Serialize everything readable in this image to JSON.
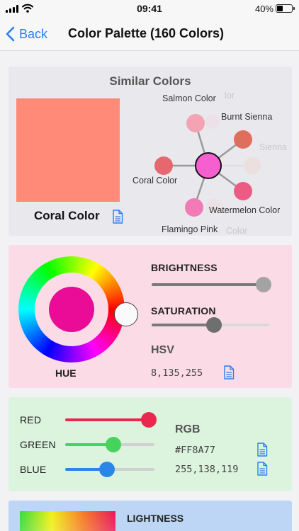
{
  "status": {
    "time": "09:41",
    "battery_pct": "40%",
    "battery_level": 0.4
  },
  "nav": {
    "back_label": "Back",
    "title": "Color Palette (160 Colors)"
  },
  "similar": {
    "title": "Similar Colors",
    "color_name": "Coral Color",
    "color_hex": "#FF8A77",
    "center_color": "#f55fcf",
    "nodes": [
      {
        "name": "Salmon Color",
        "color": "#f4a3b2"
      },
      {
        "name": "Burnt Sienna",
        "color": "#e06e5d"
      },
      {
        "name": "Coral Color",
        "color": "#e5686f"
      },
      {
        "name": "Watermelon Color",
        "color": "#ec5b83"
      },
      {
        "name": "Flamingo Pink",
        "color": "#f27ab7"
      }
    ],
    "ghost_labels": [
      "Sienna",
      "Color",
      "lor"
    ]
  },
  "hsv": {
    "hue_label": "HUE",
    "hue_color": "#ea0c96",
    "brightness_label": "BRIGHTNESS",
    "brightness_value": 1.0,
    "saturation_label": "SATURATION",
    "saturation_value": 0.53,
    "model_title": "HSV",
    "value": "8,135,255"
  },
  "rgb": {
    "red_label": "RED",
    "green_label": "GREEN",
    "blue_label": "BLUE",
    "red_value": 1.0,
    "green_value": 0.54,
    "blue_value": 0.47,
    "model_title": "RGB",
    "hex": "#FF8A77",
    "value": "255,138,119"
  },
  "lightness": {
    "label": "LIGHTNESS"
  },
  "colors": {
    "accent": "#2b7cf6",
    "red": "#e9284f",
    "green": "#46d35c",
    "blue": "#2a86e8"
  }
}
